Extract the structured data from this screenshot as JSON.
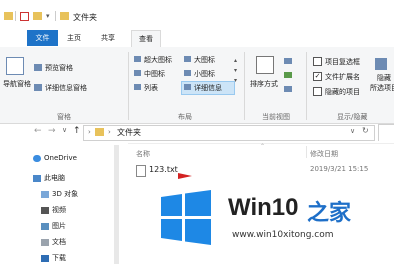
{
  "window": {
    "title": "文件夹"
  },
  "ribbon_tabs": [
    "文件",
    "主页",
    "共享",
    "查看"
  ],
  "ribbon": {
    "pane": {
      "nav_pane": "导航窗格",
      "preview": "预览窗格",
      "details": "详细信息窗格",
      "group": "窗格"
    },
    "layout": {
      "items": [
        "超大图标",
        "大图标",
        "中图标",
        "小图标",
        "列表",
        "详细信息"
      ],
      "group": "布局"
    },
    "current_view": {
      "sort": "排序方式",
      "group": "当前视图"
    },
    "show_hide": {
      "item_checkbox": "项目复选框",
      "file_ext": "文件扩展名",
      "hidden_items": "隐藏的项目",
      "hide_selected": "隐藏",
      "hide_selected_2": "所选项目",
      "group": "显示/隐藏"
    }
  },
  "address": {
    "path": "文件夹"
  },
  "nav": {
    "items": [
      "OneDrive",
      "此电脑",
      "3D 对象",
      "视频",
      "图片",
      "文档",
      "下载"
    ]
  },
  "columns": {
    "name": "名称",
    "modified": "修改日期"
  },
  "files": [
    {
      "name": "123.txt",
      "modified": "2019/3/21 15:15"
    }
  ],
  "watermark": {
    "brand": "Win10",
    "brand_cn": "之家",
    "url": "www.win10xitong.com"
  }
}
